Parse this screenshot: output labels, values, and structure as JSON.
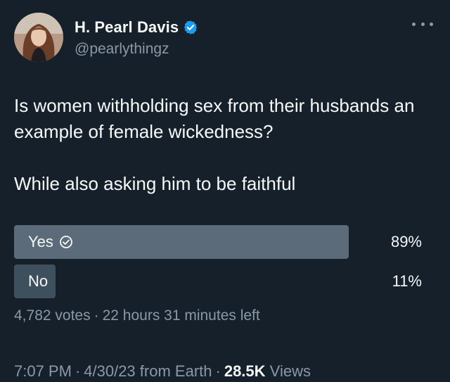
{
  "author": {
    "display_name": "H. Pearl Davis",
    "handle": "@pearlythingz",
    "verified": true,
    "verified_color": "#1d9bf0"
  },
  "tweet": {
    "paragraphs": [
      "Is women withholding sex from their husbands an example of female wickedness?",
      "While also asking him to be faithful"
    ]
  },
  "poll": {
    "options": [
      {
        "label": "Yes",
        "percent_label": "89%",
        "percent": 89,
        "winner": true
      },
      {
        "label": "No",
        "percent_label": "11%",
        "percent": 11,
        "winner": false
      }
    ],
    "votes": "4,782 votes",
    "separator": "·",
    "time_left": "22 hours 31 minutes left"
  },
  "meta": {
    "time": "7:07 PM",
    "date": "4/30/23",
    "source": "from Earth",
    "views_count": "28.5K",
    "views_label": "Views",
    "separator": "·"
  },
  "colors": {
    "background": "#15202b",
    "text_primary": "#f7f9f9",
    "text_secondary": "#8b98a5",
    "poll_winner_bar": "#5b6b79",
    "poll_other_bar": "#3e4f5d"
  },
  "icons": {
    "verified": "verified-badge-icon",
    "more": "more-options-icon",
    "check": "check-circle-icon"
  }
}
